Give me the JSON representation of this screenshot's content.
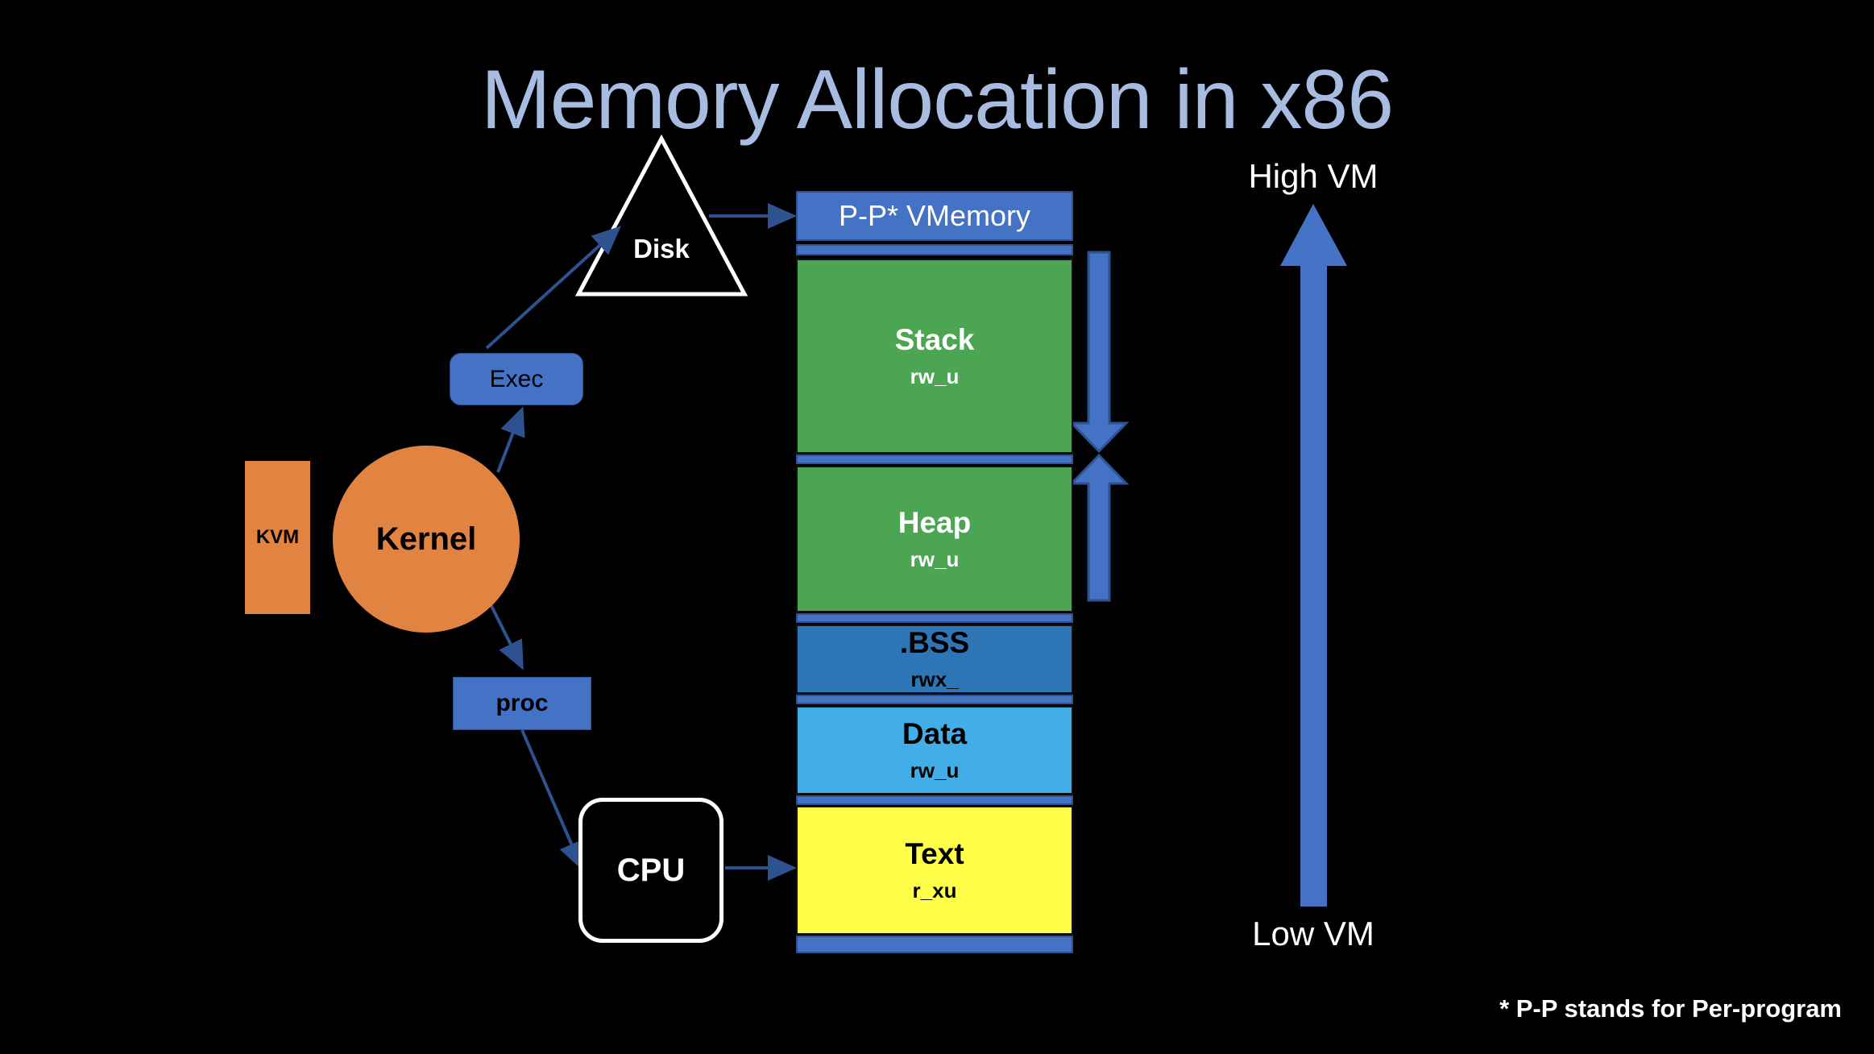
{
  "slide": {
    "title": "Memory Allocation in x86",
    "background_color": "#000000",
    "title_color": "#A8BBE0",
    "footnote": "* P-P stands for Per-program"
  },
  "memory": {
    "header_label": "P-P* VMemory",
    "header_color": "#4472C4",
    "segments": [
      {
        "name": "Stack",
        "perm": "rw_u",
        "color": "#4CA552",
        "text_color": "#FFFFFF"
      },
      {
        "name": "Heap",
        "perm": "rw_u",
        "color": "#4CA552",
        "text_color": "#FFFFFF"
      },
      {
        "name": ".BSS",
        "perm": "rwx_",
        "color": "#2E75B6",
        "text_color": "#000000"
      },
      {
        "name": "Data",
        "perm": "rw_u",
        "color": "#41AEE8",
        "text_color": "#000000"
      },
      {
        "name": "Text",
        "perm": "r_xu",
        "color": "#FFFF49",
        "text_color": "#000000"
      }
    ]
  },
  "nodes": {
    "disk": "Disk",
    "kernel": "Kernel",
    "kvm": "KVM",
    "exec": "Exec",
    "proc": "proc",
    "cpu": "CPU"
  },
  "axis": {
    "high_label": "High VM",
    "low_label": "Low VM",
    "arrow_color": "#4472C4"
  },
  "growth_arrows": {
    "stack_direction": "down",
    "heap_direction": "up",
    "color": "#4472C4"
  },
  "colors": {
    "accent_blue": "#4472C4",
    "orange": "#E18341",
    "green": "#4CA552",
    "dark_blue": "#2E75B6",
    "light_blue": "#41AEE8",
    "yellow": "#FFFF49",
    "white": "#FFFFFF"
  }
}
